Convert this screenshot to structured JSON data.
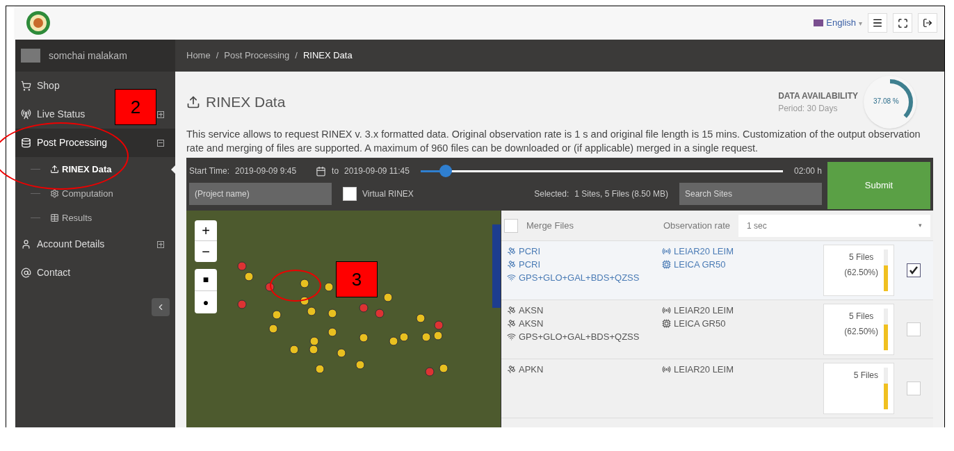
{
  "header": {
    "language": "English",
    "language_caret": "▾"
  },
  "sidebar": {
    "user": "somchai malakam",
    "items": [
      {
        "label": "Shop",
        "selected": false
      },
      {
        "label": "Live Status",
        "selected": false,
        "expanded": false
      },
      {
        "label": "Post Processing",
        "selected": false,
        "expanded": true,
        "children": [
          {
            "label": "RINEX Data",
            "selected": true
          },
          {
            "label": "Computation",
            "selected": false
          },
          {
            "label": "Results",
            "selected": false
          }
        ]
      },
      {
        "label": "Account Details",
        "selected": false,
        "expanded": false
      },
      {
        "label": "Contact",
        "selected": false
      }
    ]
  },
  "breadcrumb": {
    "separator": "/",
    "items": [
      "Home",
      "Post Processing",
      "RINEX Data"
    ]
  },
  "page_title": "RINEX Data",
  "availability": {
    "title": "DATA AVAILABILITY",
    "period": "Period: 30 Days",
    "reading": "37.08 %",
    "level": 0.3708
  },
  "description": "This service allows to request RINEX v. 3.x formatted data. Original observation rate is 1 s and original file length is 15 mins. Customization of the output observation rate and merging of files are supported. A maximum of 960 files can be downloaded or (if applicable) merged in a single request.",
  "toolbar": {
    "start_label": "Start Time:",
    "start": "2019-09-09 9:45",
    "to_label": "to",
    "end": "2019-09-09 11:45",
    "duration": "02:00 h",
    "level": 0.07,
    "project_placeholder": "(Project name)",
    "virtual_rinex": {
      "label": "Virtual RINEX",
      "checked": false
    },
    "selected_label": "Selected:",
    "selected_value": "1 Sites, 5 Files (8.50 MB)",
    "search_placeholder": "Search Sites",
    "submit": "Submit"
  },
  "map": {
    "zoom_in": "+",
    "zoom_out": "−",
    "draw_square": "■",
    "draw_circle": "●"
  },
  "list_header": {
    "merge_files": {
      "label": "Merge Files",
      "checked": false
    },
    "rate_label": "Observation rate",
    "rate_value": "1 sec"
  },
  "sites": [
    {
      "selected": true,
      "station": "PCRI",
      "marker": "PCRI",
      "systems": "GPS+GLO+GAL+BDS+QZSS",
      "antenna": "LEIAR20 LEIM",
      "receiver": "LEICA GR50",
      "files": "5 Files",
      "percent": "(62.50%)",
      "level": 0.625
    },
    {
      "selected": false,
      "station": "AKSN",
      "marker": "AKSN",
      "systems": "GPS+GLO+GAL+BDS+QZSS",
      "antenna": "LEIAR20 LEIM",
      "receiver": "LEICA GR50",
      "files": "5 Files",
      "percent": "(62.50%)",
      "level": 0.625
    },
    {
      "selected": false,
      "station": "APKN",
      "antenna": "LEIAR20 LEIM",
      "files": "5 Files",
      "level": 0.625
    }
  ],
  "annotations": [
    "2",
    "3"
  ]
}
